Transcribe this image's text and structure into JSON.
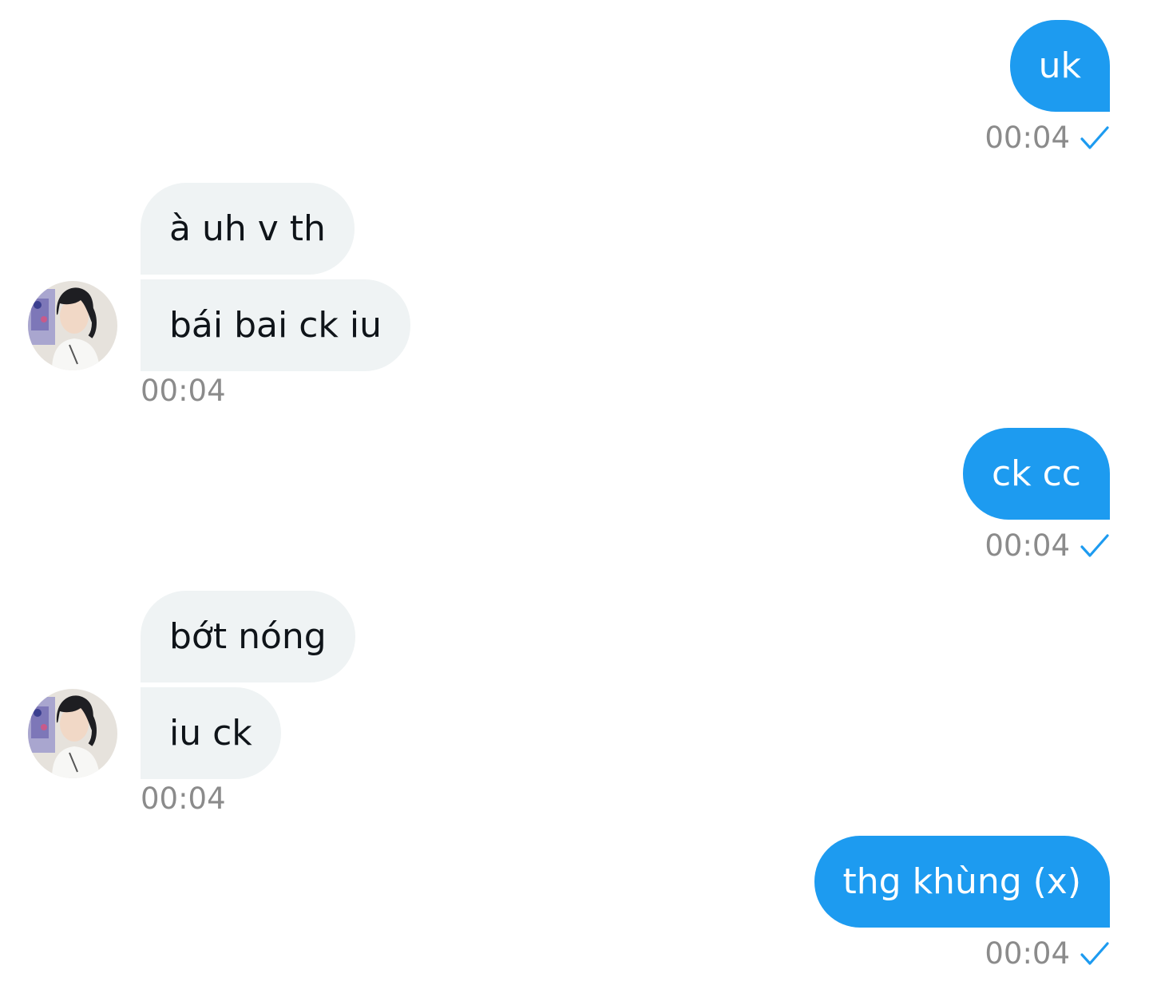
{
  "messages": {
    "m1": {
      "text": "uk",
      "time": "00:04"
    },
    "m2": {
      "text": "à uh v th"
    },
    "m3": {
      "text": "bái bai ck iu",
      "time": "00:04"
    },
    "m4": {
      "text": "ck cc",
      "time": "00:04"
    },
    "m5": {
      "text": "bớt nóng"
    },
    "m6": {
      "text": "iu ck",
      "time": "00:04"
    },
    "m7": {
      "text": "thg khùng (x)",
      "time": "00:04"
    }
  },
  "colors": {
    "sent_bubble": "#1d9bf0",
    "received_bubble": "#eff3f4",
    "timestamp": "#8b8b8b",
    "read_check": "#1d9bf0"
  },
  "icons": {
    "read_receipt": "check-icon"
  }
}
